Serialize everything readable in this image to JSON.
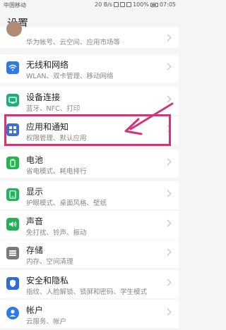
{
  "status_bar": {
    "carrier": "中国移动",
    "speed": "20 B/s",
    "battery": "100%",
    "time": "07:05"
  },
  "page_title": "设置",
  "account_sub": "华为帐号、云空间、应用市场等",
  "items": [
    {
      "label": "无线和网络",
      "sub": "WLAN、双卡管理、移动网络",
      "icon": "wifi-icon",
      "color": "#2f7be5"
    },
    {
      "label": "设备连接",
      "sub": "蓝牙、NFC、打印",
      "icon": "device-connection-icon",
      "color": "#1dae7a"
    },
    {
      "label": "应用和通知",
      "sub": "权限管理、默认应用",
      "icon": "apps-icon",
      "color": "#3a6fd8"
    },
    {
      "label": "电池",
      "sub": "省电模式、耗电排行",
      "icon": "battery-icon",
      "color": "#25b450"
    },
    {
      "label": "显示",
      "sub": "护眼模式、桌面风格、壁纸",
      "icon": "display-icon",
      "color": "#21b45c"
    },
    {
      "label": "声音",
      "sub": "免打扰、铃声、振动",
      "icon": "sound-icon",
      "color": "#23b155"
    },
    {
      "label": "存储",
      "sub": "内存、空间清理",
      "icon": "storage-icon",
      "color": "#7a7a7a"
    },
    {
      "label": "安全和隐私",
      "sub": "指纹、人脸解锁、锁屏和密码、学生模式",
      "icon": "shield-icon",
      "color": "#2d6bd8"
    },
    {
      "label": "帐户",
      "sub": "云服务、帐户",
      "icon": "account-icon",
      "color": "#2f7be5"
    }
  ],
  "annotation_color": "#d6347a"
}
